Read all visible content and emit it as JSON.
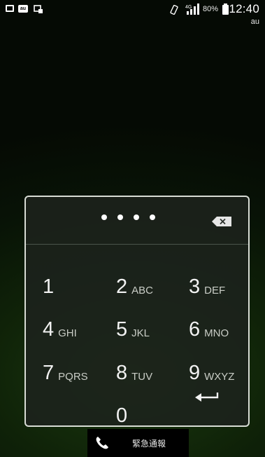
{
  "status_bar": {
    "left_icons": [
      "screenshot-icon",
      "au-app-icon",
      "image-transfer-icon"
    ],
    "network": "4G",
    "battery_percent": "80%",
    "time": "12:40"
  },
  "carrier": "au",
  "pin_entry": {
    "masked_value": "••••",
    "digits_entered": 4
  },
  "keypad": {
    "keys": [
      {
        "digit": "1",
        "letters": ""
      },
      {
        "digit": "2",
        "letters": "ABC"
      },
      {
        "digit": "3",
        "letters": "DEF"
      },
      {
        "digit": "4",
        "letters": "GHI"
      },
      {
        "digit": "5",
        "letters": "JKL"
      },
      {
        "digit": "6",
        "letters": "MNO"
      },
      {
        "digit": "7",
        "letters": "PQRS"
      },
      {
        "digit": "8",
        "letters": "TUV"
      },
      {
        "digit": "9",
        "letters": "WXYZ"
      },
      {
        "digit": "0",
        "letters": ""
      }
    ]
  },
  "emergency": {
    "label": "緊急通報"
  },
  "colors": {
    "panel_border": "#d8dcd5",
    "background_glow": "#1b3a10"
  }
}
